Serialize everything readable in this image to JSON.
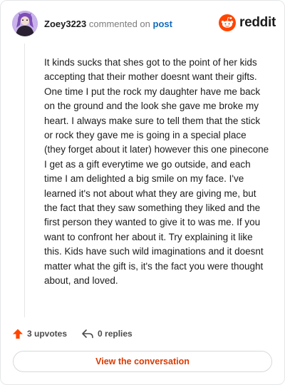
{
  "comment": {
    "username": "Zoey3223",
    "action_text": "commented on",
    "target_link": "post",
    "body": "It kinds sucks that shes got to the point of her kids accepting that their mother doesnt want their gifts. One time I put the rock my daughter have me back on the ground and the look she gave me broke my heart. I always make sure to tell them that the stick or rock they gave me is going in a special place (they forget about it later) however this one pinecone I get as a gift everytime we go outside, and each time I am delighted a big smile on my face. I've learned it's not about what they are giving me, but the fact that they saw something they liked and the first person they wanted to give it to was me. If you want to confront her about it. Try explaining it like this. Kids have such wild imaginations and it doesnt matter what the gift is, it's the fact you were thought about, and loved."
  },
  "brand": {
    "name": "reddit",
    "icon": "reddit-logo-icon",
    "color": "#ff4500"
  },
  "stats": {
    "upvotes_label": "3 upvotes",
    "replies_label": "0 replies",
    "upvote_icon": "upvote-arrow-icon",
    "reply_icon": "reply-arrow-icon",
    "upvote_color": "#ff4500"
  },
  "cta": {
    "label": "View the conversation",
    "color": "#d93a00"
  }
}
